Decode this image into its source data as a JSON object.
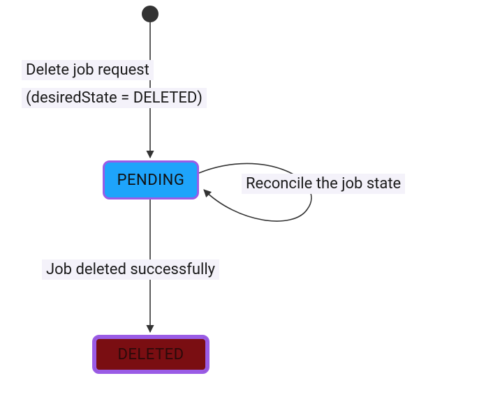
{
  "diagram": {
    "type": "state-machine",
    "states": {
      "pending": {
        "label": "PENDING",
        "fill": "#1EA4FB",
        "stroke": "#9A5CE6"
      },
      "deleted": {
        "label": "DELETED",
        "fill": "#7A0E12",
        "stroke": "#9A5CE6"
      }
    },
    "transitions": {
      "start_to_pending": {
        "line1": "Delete job request",
        "line2": "(desiredState = DELETED)"
      },
      "pending_self_loop": {
        "label": "Reconcile the job state"
      },
      "pending_to_deleted": {
        "label": "Job deleted successfully"
      }
    }
  }
}
